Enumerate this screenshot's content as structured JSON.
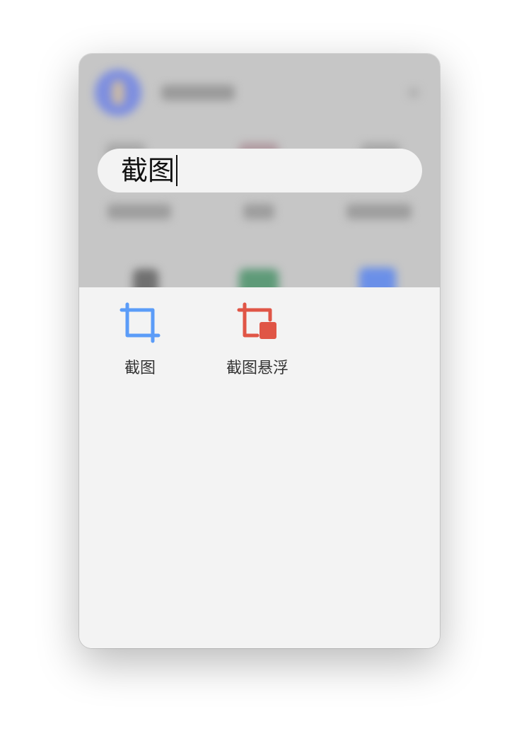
{
  "search": {
    "query": "截图"
  },
  "results": [
    {
      "label": "截图",
      "icon": "crop-icon",
      "color": "#5b9cf8"
    },
    {
      "label": "截图悬浮",
      "icon": "crop-float-icon",
      "color": "#e05546"
    }
  ],
  "colors": {
    "panel_bg": "#f3f3f3",
    "blur_bg": "#c6c6c6"
  }
}
